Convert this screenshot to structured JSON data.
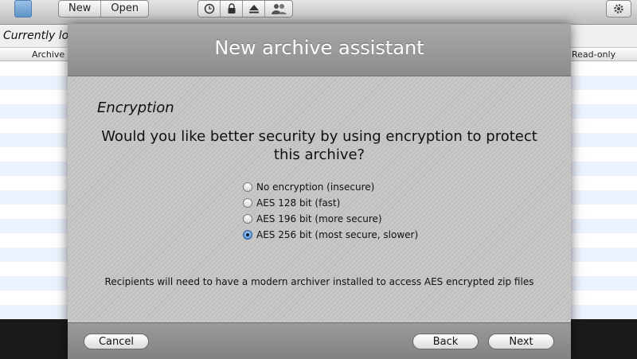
{
  "toolbar": {
    "new_label": "New",
    "open_label": "Open",
    "icons": [
      "history-icon",
      "lock-icon",
      "eject-icon",
      "people-icon",
      "gear-icon"
    ]
  },
  "main": {
    "status_text": "Currently load",
    "columns": {
      "archive": "Archive",
      "read_only": "Read-only"
    }
  },
  "dialog": {
    "title": "New archive assistant",
    "step_title": "Encryption",
    "question_line1": "Would you like better security by using encryption to protect",
    "question_line2": "this archive?",
    "options": [
      {
        "label": "No encryption (insecure)",
        "selected": false
      },
      {
        "label": "AES 128 bit (fast)",
        "selected": false
      },
      {
        "label": "AES 196 bit (more secure)",
        "selected": false
      },
      {
        "label": "AES 256 bit (most secure, slower)",
        "selected": true
      }
    ],
    "note": "Recipients will need to have a modern archiver installed to access AES encrypted zip files",
    "buttons": {
      "cancel": "Cancel",
      "back": "Back",
      "next": "Next"
    }
  },
  "colors": {
    "dialog_header": "#8c8c8c",
    "selected_radio": "#3d7fd0",
    "row_alt": "#edf3fe"
  }
}
